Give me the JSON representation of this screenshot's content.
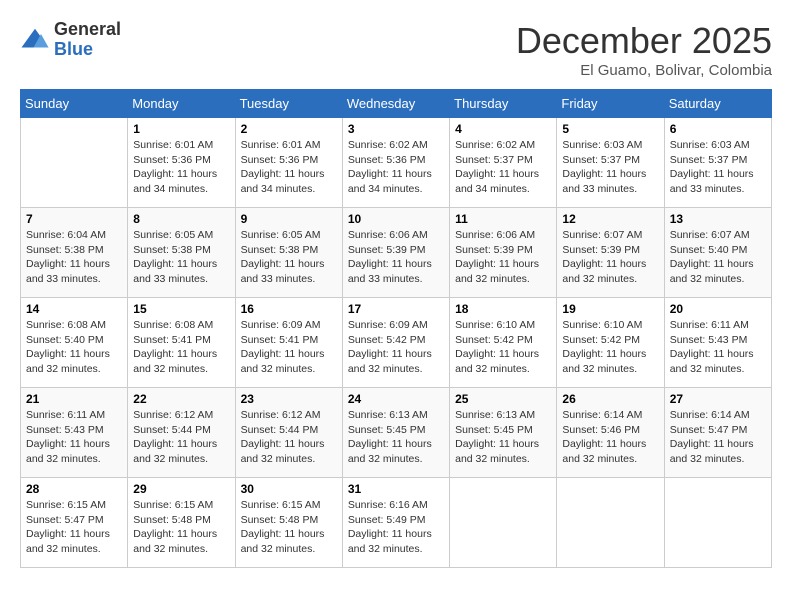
{
  "logo": {
    "line1": "General",
    "line2": "Blue"
  },
  "title": "December 2025",
  "subtitle": "El Guamo, Bolivar, Colombia",
  "days_of_week": [
    "Sunday",
    "Monday",
    "Tuesday",
    "Wednesday",
    "Thursday",
    "Friday",
    "Saturday"
  ],
  "weeks": [
    [
      {
        "day": "",
        "sunrise": "",
        "sunset": "",
        "daylight": ""
      },
      {
        "day": "1",
        "sunrise": "Sunrise: 6:01 AM",
        "sunset": "Sunset: 5:36 PM",
        "daylight": "Daylight: 11 hours and 34 minutes."
      },
      {
        "day": "2",
        "sunrise": "Sunrise: 6:01 AM",
        "sunset": "Sunset: 5:36 PM",
        "daylight": "Daylight: 11 hours and 34 minutes."
      },
      {
        "day": "3",
        "sunrise": "Sunrise: 6:02 AM",
        "sunset": "Sunset: 5:36 PM",
        "daylight": "Daylight: 11 hours and 34 minutes."
      },
      {
        "day": "4",
        "sunrise": "Sunrise: 6:02 AM",
        "sunset": "Sunset: 5:37 PM",
        "daylight": "Daylight: 11 hours and 34 minutes."
      },
      {
        "day": "5",
        "sunrise": "Sunrise: 6:03 AM",
        "sunset": "Sunset: 5:37 PM",
        "daylight": "Daylight: 11 hours and 33 minutes."
      },
      {
        "day": "6",
        "sunrise": "Sunrise: 6:03 AM",
        "sunset": "Sunset: 5:37 PM",
        "daylight": "Daylight: 11 hours and 33 minutes."
      }
    ],
    [
      {
        "day": "7",
        "sunrise": "Sunrise: 6:04 AM",
        "sunset": "Sunset: 5:38 PM",
        "daylight": "Daylight: 11 hours and 33 minutes."
      },
      {
        "day": "8",
        "sunrise": "Sunrise: 6:05 AM",
        "sunset": "Sunset: 5:38 PM",
        "daylight": "Daylight: 11 hours and 33 minutes."
      },
      {
        "day": "9",
        "sunrise": "Sunrise: 6:05 AM",
        "sunset": "Sunset: 5:38 PM",
        "daylight": "Daylight: 11 hours and 33 minutes."
      },
      {
        "day": "10",
        "sunrise": "Sunrise: 6:06 AM",
        "sunset": "Sunset: 5:39 PM",
        "daylight": "Daylight: 11 hours and 33 minutes."
      },
      {
        "day": "11",
        "sunrise": "Sunrise: 6:06 AM",
        "sunset": "Sunset: 5:39 PM",
        "daylight": "Daylight: 11 hours and 32 minutes."
      },
      {
        "day": "12",
        "sunrise": "Sunrise: 6:07 AM",
        "sunset": "Sunset: 5:39 PM",
        "daylight": "Daylight: 11 hours and 32 minutes."
      },
      {
        "day": "13",
        "sunrise": "Sunrise: 6:07 AM",
        "sunset": "Sunset: 5:40 PM",
        "daylight": "Daylight: 11 hours and 32 minutes."
      }
    ],
    [
      {
        "day": "14",
        "sunrise": "Sunrise: 6:08 AM",
        "sunset": "Sunset: 5:40 PM",
        "daylight": "Daylight: 11 hours and 32 minutes."
      },
      {
        "day": "15",
        "sunrise": "Sunrise: 6:08 AM",
        "sunset": "Sunset: 5:41 PM",
        "daylight": "Daylight: 11 hours and 32 minutes."
      },
      {
        "day": "16",
        "sunrise": "Sunrise: 6:09 AM",
        "sunset": "Sunset: 5:41 PM",
        "daylight": "Daylight: 11 hours and 32 minutes."
      },
      {
        "day": "17",
        "sunrise": "Sunrise: 6:09 AM",
        "sunset": "Sunset: 5:42 PM",
        "daylight": "Daylight: 11 hours and 32 minutes."
      },
      {
        "day": "18",
        "sunrise": "Sunrise: 6:10 AM",
        "sunset": "Sunset: 5:42 PM",
        "daylight": "Daylight: 11 hours and 32 minutes."
      },
      {
        "day": "19",
        "sunrise": "Sunrise: 6:10 AM",
        "sunset": "Sunset: 5:42 PM",
        "daylight": "Daylight: 11 hours and 32 minutes."
      },
      {
        "day": "20",
        "sunrise": "Sunrise: 6:11 AM",
        "sunset": "Sunset: 5:43 PM",
        "daylight": "Daylight: 11 hours and 32 minutes."
      }
    ],
    [
      {
        "day": "21",
        "sunrise": "Sunrise: 6:11 AM",
        "sunset": "Sunset: 5:43 PM",
        "daylight": "Daylight: 11 hours and 32 minutes."
      },
      {
        "day": "22",
        "sunrise": "Sunrise: 6:12 AM",
        "sunset": "Sunset: 5:44 PM",
        "daylight": "Daylight: 11 hours and 32 minutes."
      },
      {
        "day": "23",
        "sunrise": "Sunrise: 6:12 AM",
        "sunset": "Sunset: 5:44 PM",
        "daylight": "Daylight: 11 hours and 32 minutes."
      },
      {
        "day": "24",
        "sunrise": "Sunrise: 6:13 AM",
        "sunset": "Sunset: 5:45 PM",
        "daylight": "Daylight: 11 hours and 32 minutes."
      },
      {
        "day": "25",
        "sunrise": "Sunrise: 6:13 AM",
        "sunset": "Sunset: 5:45 PM",
        "daylight": "Daylight: 11 hours and 32 minutes."
      },
      {
        "day": "26",
        "sunrise": "Sunrise: 6:14 AM",
        "sunset": "Sunset: 5:46 PM",
        "daylight": "Daylight: 11 hours and 32 minutes."
      },
      {
        "day": "27",
        "sunrise": "Sunrise: 6:14 AM",
        "sunset": "Sunset: 5:47 PM",
        "daylight": "Daylight: 11 hours and 32 minutes."
      }
    ],
    [
      {
        "day": "28",
        "sunrise": "Sunrise: 6:15 AM",
        "sunset": "Sunset: 5:47 PM",
        "daylight": "Daylight: 11 hours and 32 minutes."
      },
      {
        "day": "29",
        "sunrise": "Sunrise: 6:15 AM",
        "sunset": "Sunset: 5:48 PM",
        "daylight": "Daylight: 11 hours and 32 minutes."
      },
      {
        "day": "30",
        "sunrise": "Sunrise: 6:15 AM",
        "sunset": "Sunset: 5:48 PM",
        "daylight": "Daylight: 11 hours and 32 minutes."
      },
      {
        "day": "31",
        "sunrise": "Sunrise: 6:16 AM",
        "sunset": "Sunset: 5:49 PM",
        "daylight": "Daylight: 11 hours and 32 minutes."
      },
      {
        "day": "",
        "sunrise": "",
        "sunset": "",
        "daylight": ""
      },
      {
        "day": "",
        "sunrise": "",
        "sunset": "",
        "daylight": ""
      },
      {
        "day": "",
        "sunrise": "",
        "sunset": "",
        "daylight": ""
      }
    ]
  ]
}
